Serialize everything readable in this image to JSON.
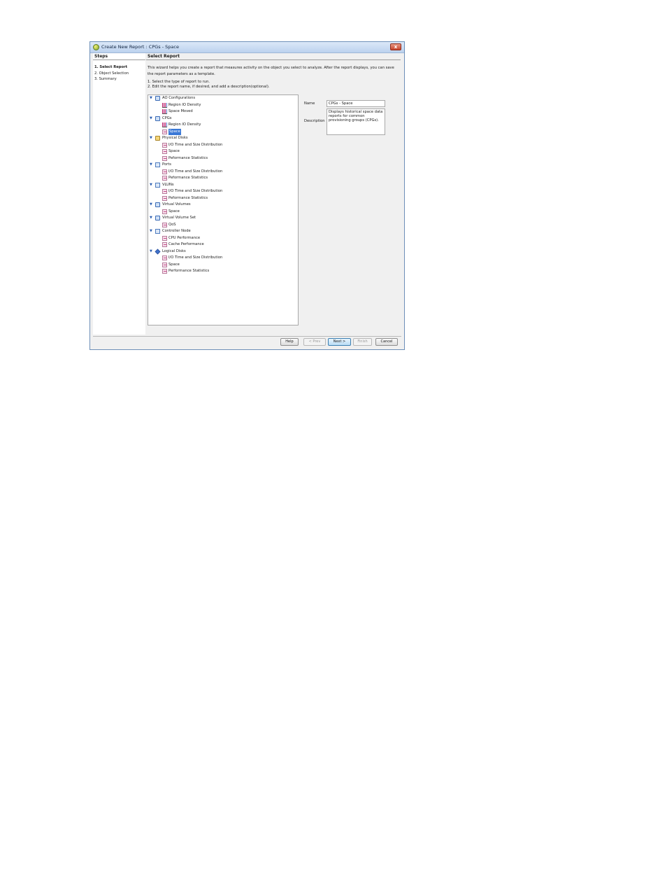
{
  "window": {
    "title": "Create New Report : CPGs - Space",
    "close_label": "x"
  },
  "steps": {
    "header": "Steps",
    "items": [
      "1. Select Report",
      "2. Object Selection",
      "3. Summary"
    ]
  },
  "main": {
    "header": "Select Report",
    "intro": "This wizard helps you create a report that measures activity on the object you select to analyze. After the report displays, you can save the report parameters as a template.",
    "instruction_1": "1. Select the type of report to run.",
    "instruction_2": "2. Edit the report name, if desired, and add a description(optional).",
    "tree": [
      {
        "label": "AO Configurations",
        "icon": "folder-icon",
        "children": [
          "Region IO Density",
          "Space Moved"
        ],
        "child_icon": "bar-chart-icon"
      },
      {
        "label": "CPGs",
        "icon": "folder-icon",
        "children": [
          "Region IO Density",
          "Space"
        ],
        "child_icon": "mixed"
      },
      {
        "label": "Physical Disks",
        "icon": "disk-icon",
        "children": [
          "I/O Time and Size Distribution",
          "Space",
          "Peformance Statistics"
        ],
        "child_icon": "report-icon"
      },
      {
        "label": "Ports",
        "icon": "network-icon",
        "children": [
          "I/O Time and Size Distribution",
          "Peformance Statistics"
        ],
        "child_icon": "report-icon"
      },
      {
        "label": "VLUNs",
        "icon": "monitor-icon",
        "children": [
          "I/O Time and Size Distribution",
          "Peformance Statistics"
        ],
        "child_icon": "report-icon"
      },
      {
        "label": "Virtual Volumes",
        "icon": "volume-icon",
        "children": [
          "Space"
        ],
        "child_icon": "report-icon"
      },
      {
        "label": "Virtual Volume Set",
        "icon": "volume-set-icon",
        "children": [
          "QoS"
        ],
        "child_icon": "report-icon"
      },
      {
        "label": "Controller Node",
        "icon": "node-icon",
        "children": [
          "CPU Performance",
          "Cache Performance"
        ],
        "child_icon": "report-icon"
      },
      {
        "label": "Logical Disks",
        "icon": "cube-icon",
        "children": [
          "I/O Time and Size Distribution",
          "Space",
          "Performance Statistics"
        ],
        "child_icon": "report-icon"
      }
    ],
    "selected": "CPGs > Space",
    "form": {
      "name_label": "Name",
      "name_value": "CPGs - Space",
      "description_label": "Description",
      "description_value": "Displays historical space data reports for common provisioning groups (CPGs)."
    }
  },
  "buttons": {
    "help": "Help",
    "prev": "< Prev",
    "next": "Next >",
    "finish": "Finish",
    "cancel": "Cancel"
  }
}
